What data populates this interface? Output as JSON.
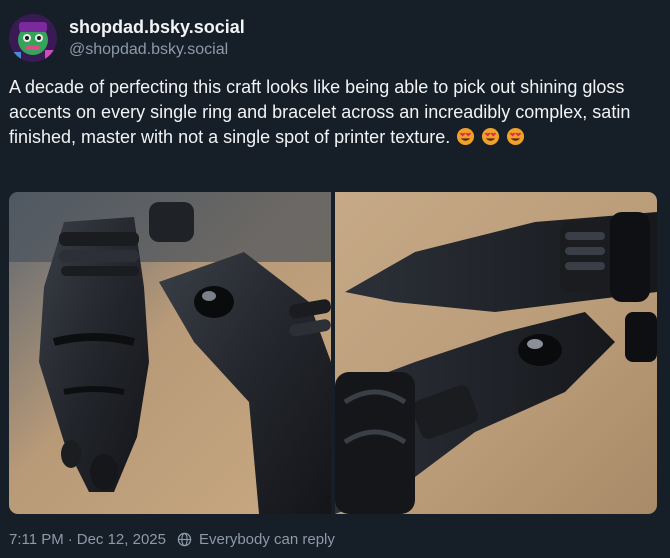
{
  "author": {
    "display_name": "shopdad.bsky.social",
    "handle": "@shopdad.bsky.social",
    "avatar_icon": "cartoon-avatar-icon"
  },
  "post": {
    "text": "A decade of perfecting this craft looks like being able to pick out shining gloss accents on every single ring and bracelet across an increadibly complex, satin finished, master with not a single spot of printer texture.",
    "emojis": [
      "heart-eyes-emoji",
      "heart-eyes-emoji",
      "heart-eyes-emoji"
    ]
  },
  "images": [
    {
      "subject": "black 3d-printed hands with rings and bracelets"
    },
    {
      "subject": "black 3d-printed hands holding a gemstone"
    }
  ],
  "footer": {
    "time": "7:11 PM",
    "separator": "·",
    "date": "Dec 12, 2025",
    "reply_setting": "Everybody can reply",
    "reply_icon": "globe-icon"
  },
  "colors": {
    "background": "#161e27",
    "text_primary": "#f1f3f5",
    "text_secondary": "#8c9aaa"
  }
}
